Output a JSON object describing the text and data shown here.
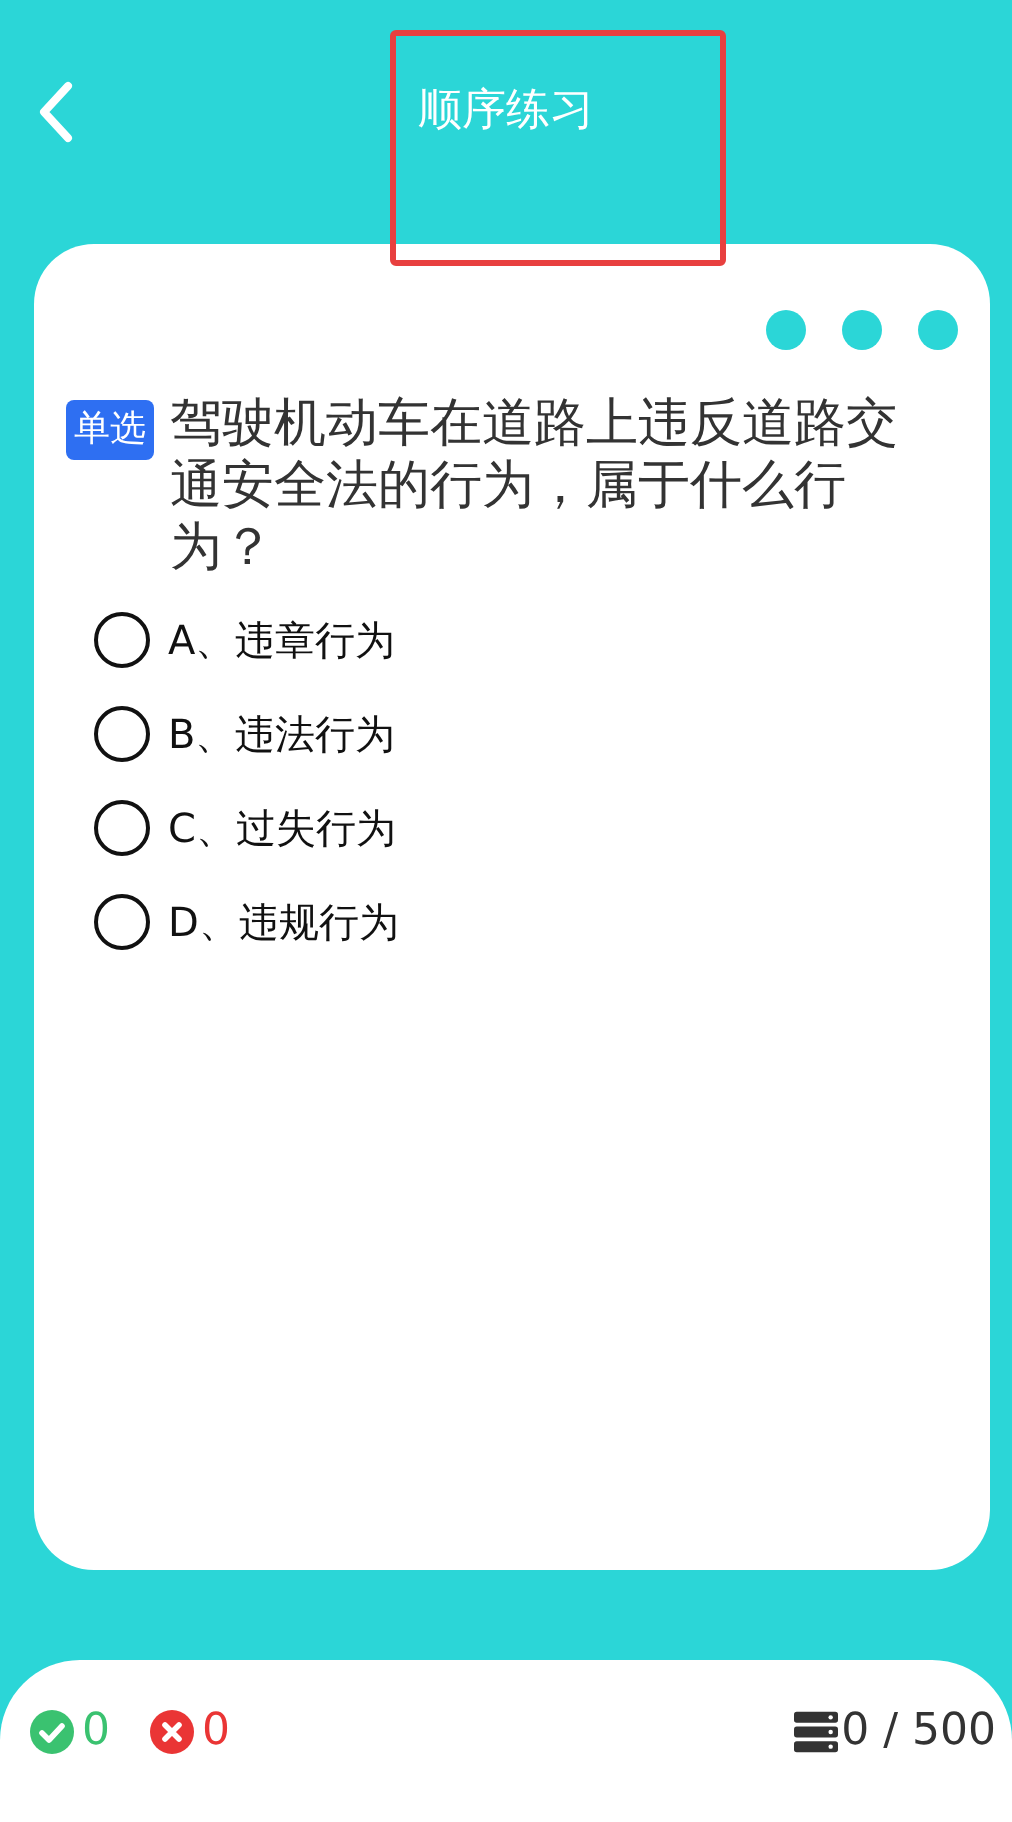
{
  "header": {
    "title": "顺序练习"
  },
  "question": {
    "type_badge": "单选",
    "text": "驾驶机动车在道路上违反道路交通安全法的行为，属于什么行为？"
  },
  "options": [
    {
      "label": "A、违章行为",
      "selected": false
    },
    {
      "label": "B、违法行为",
      "selected": false
    },
    {
      "label": "C、过失行为",
      "selected": false
    },
    {
      "label": "D、违规行为",
      "selected": false
    }
  ],
  "footer": {
    "correct_count": "0",
    "wrong_count": "0",
    "progress": "0 / 500"
  }
}
